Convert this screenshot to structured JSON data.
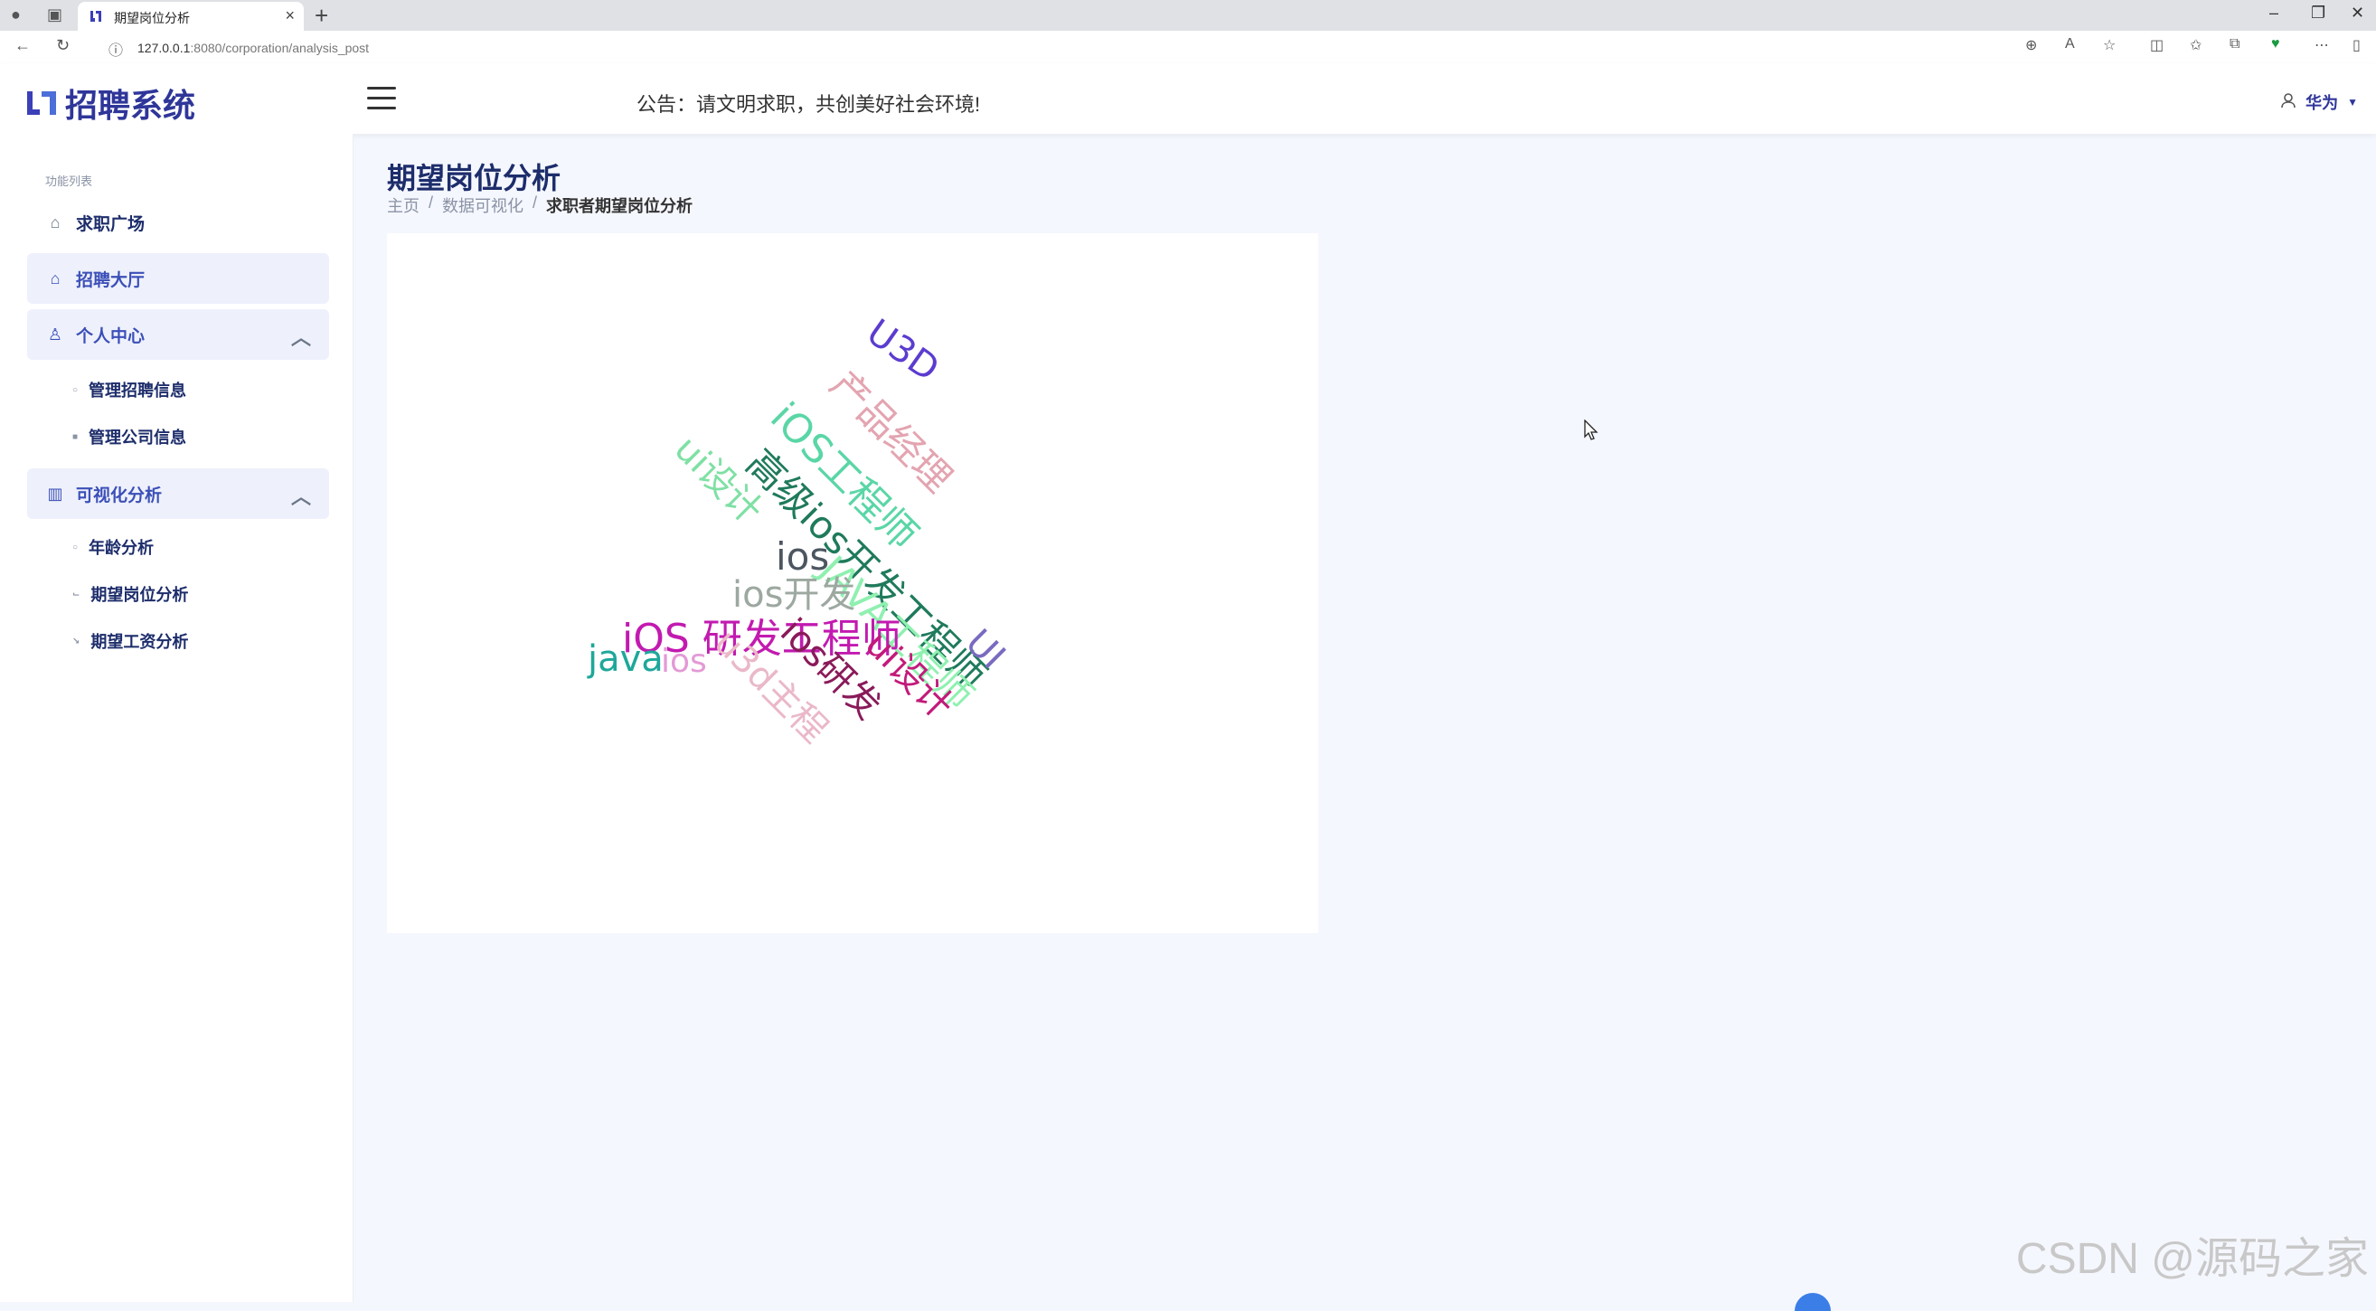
{
  "browser": {
    "tab_title": "期望岗位分析",
    "url_host": "127.0.0.1",
    "url_rest": ":8080/corporation/analysis_post"
  },
  "header": {
    "logo_text": "招聘系统",
    "notice": "公告：请文明求职，共创美好社会环境!",
    "user_name": "华为"
  },
  "sidebar": {
    "caption": "功能列表",
    "items": [
      {
        "label": "求职广场",
        "icon": "home-icon"
      },
      {
        "label": "招聘大厅",
        "icon": "house-icon"
      },
      {
        "label": "个人中心",
        "icon": "user-icon"
      },
      {
        "label": "可视化分析",
        "icon": "bar-chart-icon"
      }
    ],
    "personal_sub": [
      "管理招聘信息",
      "管理公司信息"
    ],
    "visual_sub": [
      "年龄分析",
      "期望岗位分析",
      "期望工资分析"
    ]
  },
  "main": {
    "title": "期望岗位分析",
    "breadcrumb": [
      "主页",
      "数据可视化",
      "求职者期望岗位分析"
    ]
  },
  "chart_data": {
    "type": "wordcloud",
    "words": [
      {
        "text": "U3D",
        "color": "#5b3ccf"
      },
      {
        "text": "产品经理",
        "color": "#e3a4b0"
      },
      {
        "text": "iOS工程师",
        "color": "#5ad6a6"
      },
      {
        "text": "高级ios开发工程师",
        "color": "#1f7a5c"
      },
      {
        "text": "ui设计",
        "color": "#7fe0a4"
      },
      {
        "text": "ios",
        "color": "#4c5660"
      },
      {
        "text": "JAVA工程师",
        "color": "#8ff0b0"
      },
      {
        "text": "ios开发",
        "color": "#9ca8a0"
      },
      {
        "text": "iOS 研发工程师",
        "color": "#c21ab0"
      },
      {
        "text": "UI",
        "color": "#7a6ac0"
      },
      {
        "text": "java",
        "color": "#1ea79a"
      },
      {
        "text": "ios",
        "color": "#e39ad6"
      },
      {
        "text": "u3d主程",
        "color": "#eab8c8"
      },
      {
        "text": "ios研发",
        "color": "#8a1a5a"
      },
      {
        "text": "ui设计",
        "color": "#c21a7a"
      }
    ]
  },
  "watermark": "CSDN @源码之家"
}
